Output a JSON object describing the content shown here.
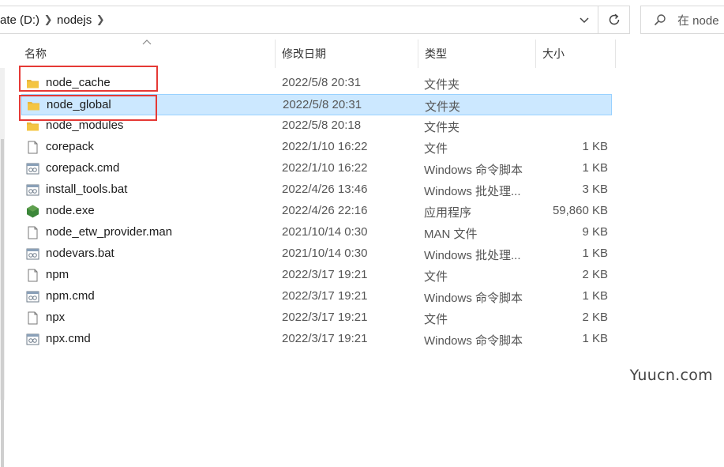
{
  "address": {
    "crumbs": [
      "ate (D:)",
      "nodejs"
    ]
  },
  "search": {
    "placeholder": "在 node"
  },
  "columns": {
    "name": "名称",
    "date": "修改日期",
    "type": "类型",
    "size": "大小"
  },
  "files": [
    {
      "name": "node_cache",
      "date": "2022/5/8 20:31",
      "type": "文件夹",
      "size": "",
      "icon": "folder-icon",
      "selected": false
    },
    {
      "name": "node_global",
      "date": "2022/5/8 20:31",
      "type": "文件夹",
      "size": "",
      "icon": "folder-icon",
      "selected": true
    },
    {
      "name": "node_modules",
      "date": "2022/5/8 20:18",
      "type": "文件夹",
      "size": "",
      "icon": "folder-icon",
      "selected": false
    },
    {
      "name": "corepack",
      "date": "2022/1/10 16:22",
      "type": "文件",
      "size": "1 KB",
      "icon": "file-icon",
      "selected": false
    },
    {
      "name": "corepack.cmd",
      "date": "2022/1/10 16:22",
      "type": "Windows 命令脚本",
      "size": "1 KB",
      "icon": "script-file-icon",
      "selected": false
    },
    {
      "name": "install_tools.bat",
      "date": "2022/4/26 13:46",
      "type": "Windows 批处理...",
      "size": "3 KB",
      "icon": "script-file-icon",
      "selected": false
    },
    {
      "name": "node.exe",
      "date": "2022/4/26 22:16",
      "type": "应用程序",
      "size": "59,860 KB",
      "icon": "node-exe-icon",
      "selected": false
    },
    {
      "name": "node_etw_provider.man",
      "date": "2021/10/14 0:30",
      "type": "MAN 文件",
      "size": "9 KB",
      "icon": "file-icon",
      "selected": false
    },
    {
      "name": "nodevars.bat",
      "date": "2021/10/14 0:30",
      "type": "Windows 批处理...",
      "size": "1 KB",
      "icon": "script-file-icon",
      "selected": false
    },
    {
      "name": "npm",
      "date": "2022/3/17 19:21",
      "type": "文件",
      "size": "2 KB",
      "icon": "file-icon",
      "selected": false
    },
    {
      "name": "npm.cmd",
      "date": "2022/3/17 19:21",
      "type": "Windows 命令脚本",
      "size": "1 KB",
      "icon": "script-file-icon",
      "selected": false
    },
    {
      "name": "npx",
      "date": "2022/3/17 19:21",
      "type": "文件",
      "size": "2 KB",
      "icon": "file-icon",
      "selected": false
    },
    {
      "name": "npx.cmd",
      "date": "2022/3/17 19:21",
      "type": "Windows 命令脚本",
      "size": "1 KB",
      "icon": "script-file-icon",
      "selected": false
    }
  ],
  "colors": {
    "selection": "#cce8ff",
    "selection_border": "#99d1ff",
    "highlight_box": "#e53935",
    "folder": "#f4c542"
  },
  "watermark": "Yuucn.com"
}
